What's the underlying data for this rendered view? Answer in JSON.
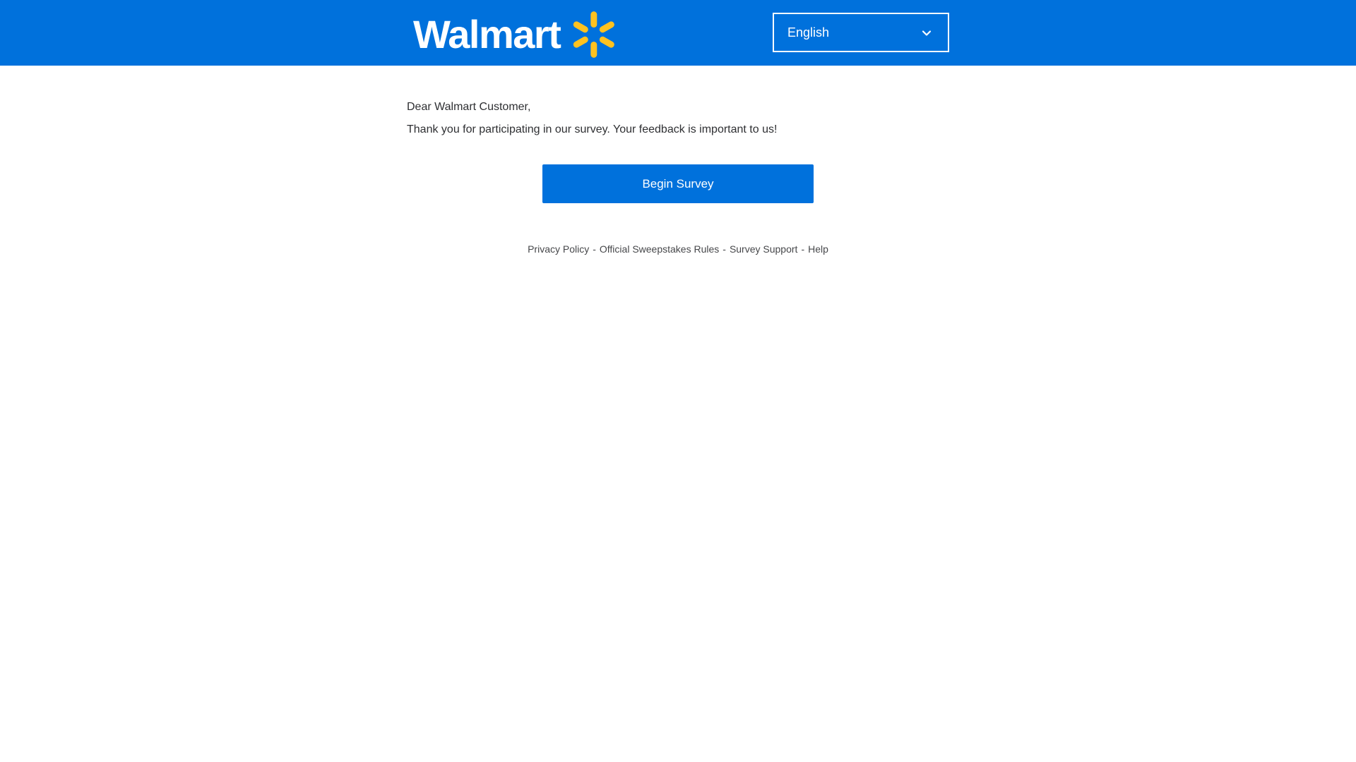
{
  "header": {
    "logo_text": "Walmart",
    "logo_icon": "walmart-spark-icon",
    "language": {
      "selected": "English",
      "icon": "chevron-down-icon"
    }
  },
  "main": {
    "greeting": "Dear Walmart Customer,",
    "message": "Thank you for participating in our survey. Your feedback is important to us!",
    "begin_button": "Begin Survey"
  },
  "footer": {
    "links": [
      "Privacy Policy",
      "Official Sweepstakes Rules",
      "Survey Support",
      "Help"
    ],
    "separator": "-"
  },
  "colors": {
    "brand_blue": "#0071dc",
    "spark_yellow": "#ffc220",
    "text": "#2e2f32",
    "footer_text": "#46474a"
  }
}
